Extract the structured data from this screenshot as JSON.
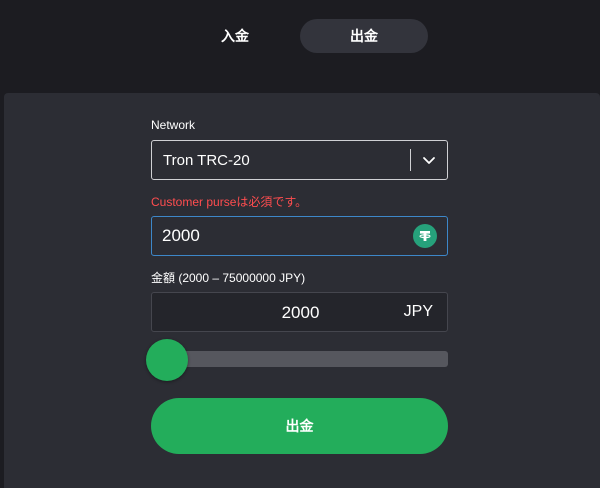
{
  "tabs": {
    "deposit_label": "入金",
    "withdraw_label": "出金",
    "active": "withdraw"
  },
  "network": {
    "label": "Network",
    "selected": "Tron TRC-20"
  },
  "error": {
    "message": "Customer purseは必須です。"
  },
  "address": {
    "value": "2000",
    "icon": "tether-icon"
  },
  "amount": {
    "label": "金額 (2000 – 75000000 JPY)",
    "value": "2000",
    "currency": "JPY",
    "slider_fraction": 0
  },
  "submit": {
    "label": "出金"
  },
  "colors": {
    "accent_green": "#23ad5b",
    "error_red": "#ff4d4f",
    "focus_blue": "#3d87c9",
    "tether_green": "#26a17b"
  }
}
